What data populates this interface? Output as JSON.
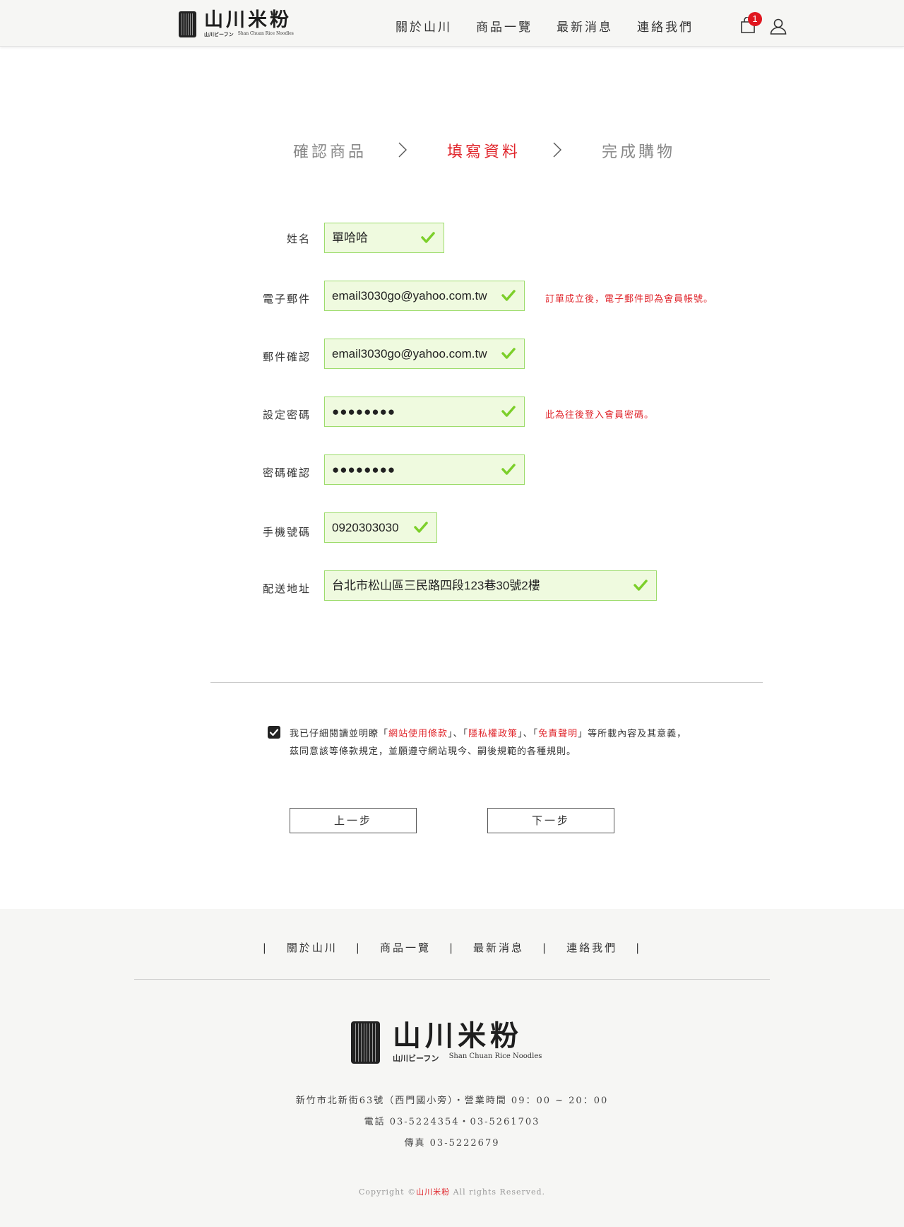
{
  "brand": {
    "name": "山川米粉",
    "sub_jp": "山川ビーフン",
    "sub_en": "Shan Chuan Rice Noodles"
  },
  "header": {
    "nav": [
      "關於山川",
      "商品一覽",
      "最新消息",
      "連絡我們"
    ],
    "cart_count": "1"
  },
  "steps": [
    {
      "label": "確認商品",
      "state": "done"
    },
    {
      "label": "填寫資料",
      "state": "active"
    },
    {
      "label": "完成購物",
      "state": "pending"
    }
  ],
  "form": {
    "name_label": "姓名",
    "name_value": "單哈哈",
    "email_label": "電子郵件",
    "email_value": "email3030go@yahoo.com.tw",
    "email_note": "訂單成立後，電子郵件即為會員帳號。",
    "email_confirm_label": "郵件確認",
    "email_confirm_value": "email3030go@yahoo.com.tw",
    "password_label": "設定密碼",
    "password_value": "●●●●●●●●",
    "password_note": "此為往後登入會員密碼。",
    "password_confirm_label": "密碼確認",
    "password_confirm_value": "●●●●●●●●",
    "phone_label": "手機號碼",
    "phone_value": "0920303030",
    "address_label": "配送地址",
    "address_value": "台北市松山區三民路四段123巷30號2樓"
  },
  "agreement": {
    "checked": true,
    "prefix": "我已仔細閱讀並明瞭「",
    "link1": "網站使用條款",
    "mid1": "」、「",
    "link2": "隱私權政策",
    "mid2": "」、「",
    "link3": "免責聲明",
    "suffix": "」等所載內容及其意義，",
    "line2": "茲同意該等條款規定，並願遵守網站現今、嗣後規範的各種規則。"
  },
  "buttons": {
    "prev": "上一步",
    "next": "下一步"
  },
  "footer": {
    "nav": [
      "關於山川",
      "商品一覽",
      "最新消息",
      "連絡我們"
    ],
    "address": "新竹市北新街63號（西門國小旁）・營業時間 09：00 ~ 20：00",
    "phone": "電話 03-5224354・03-5261703",
    "fax": "傳真 03-5222679",
    "copyright_prefix": "Copyright ©",
    "copyright_brand": "山川米粉",
    "copyright_suffix": " All rights Reserved."
  },
  "colors": {
    "accent": "#e0262c",
    "field_bg": "#effadf",
    "field_border": "#9ddc6c",
    "check": "#7ccf2a",
    "footer_bg": "#f6f6f4"
  }
}
